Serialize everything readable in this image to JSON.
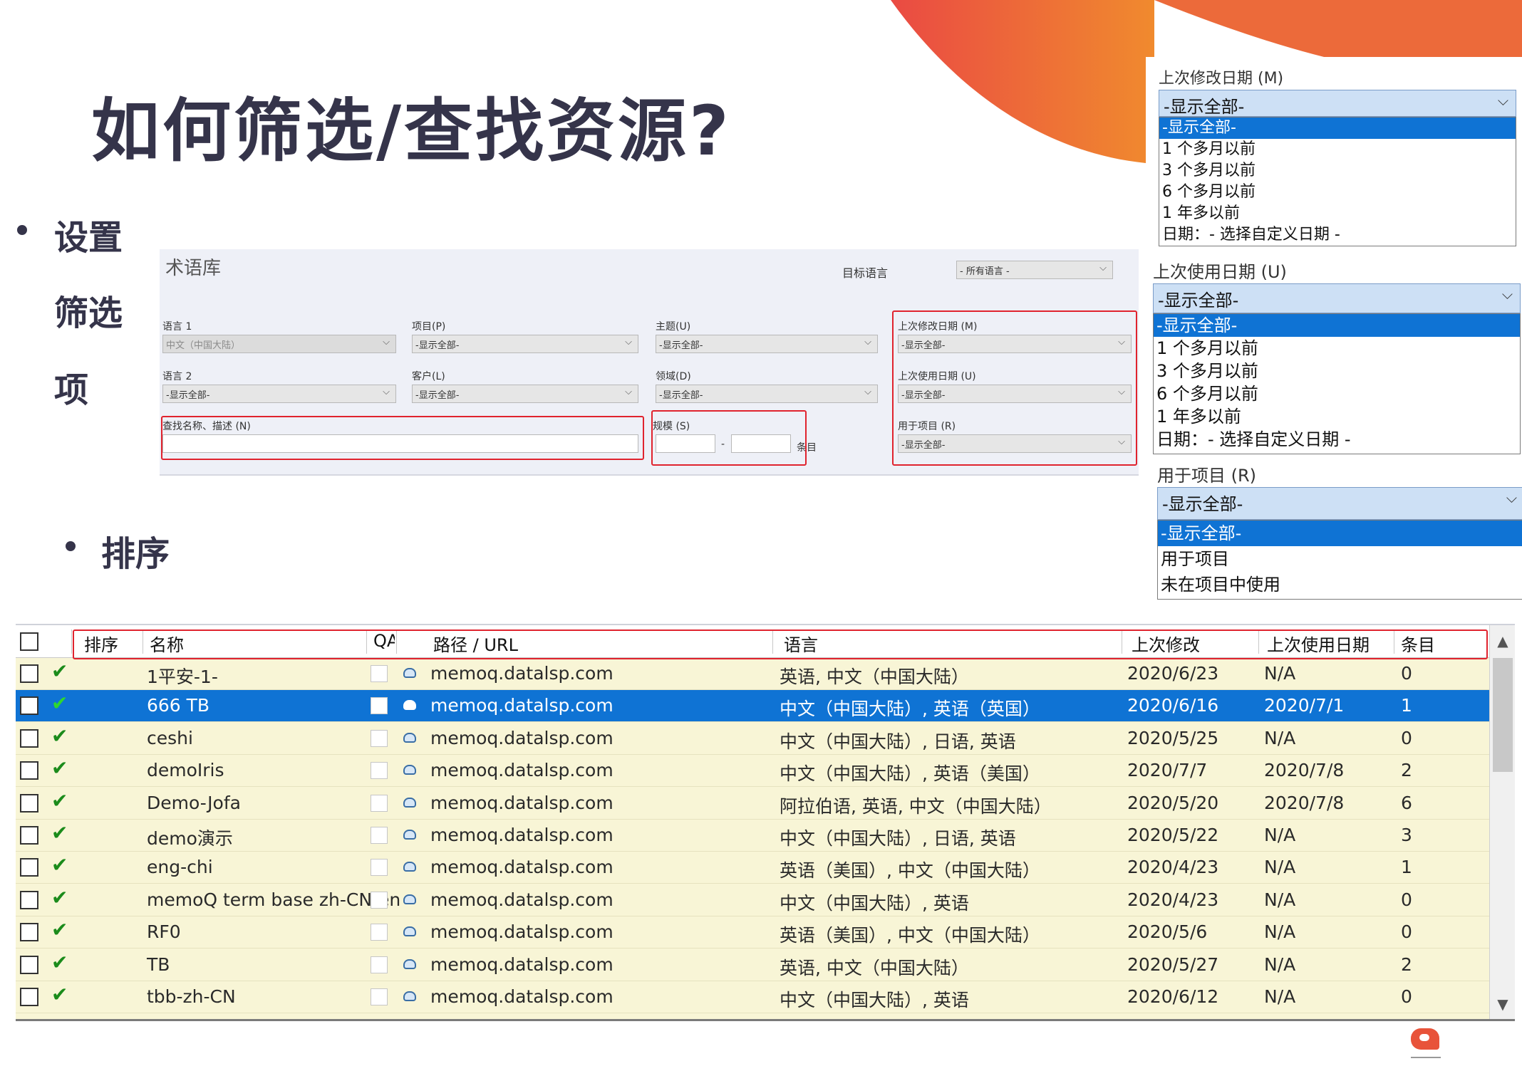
{
  "slide": {
    "title": "如何筛选/查找资源?",
    "bullet_filter_lines": [
      "设置",
      "筛选",
      "项"
    ],
    "bullet_sort": "排序"
  },
  "filter_panel": {
    "title": "术语库",
    "target_language_label": "目标语言",
    "target_language_value": "- 所有语言 -",
    "fields": {
      "lang1": {
        "label": "语言 1",
        "value": "中文（中国大陆）"
      },
      "project": {
        "label": "项目(P)",
        "value": "-显示全部-"
      },
      "subject": {
        "label": "主题(U)",
        "value": "-显示全部-"
      },
      "last_modified": {
        "label": "上次修改日期 (M)",
        "value": "-显示全部-"
      },
      "lang2": {
        "label": "语言 2",
        "value": "-显示全部-"
      },
      "client": {
        "label": "客户(L)",
        "value": "-显示全部-"
      },
      "domain": {
        "label": "领域(D)",
        "value": "-显示全部-"
      },
      "last_used": {
        "label": "上次使用日期 (U)",
        "value": "-显示全部-"
      },
      "search": {
        "label": "查找名称、描述 (N)"
      },
      "size": {
        "label": "规模 (S)",
        "dash": "-",
        "unit": "条目"
      },
      "used_in_project": {
        "label": "用于项目 (R)",
        "value": "-显示全部-"
      }
    }
  },
  "dropdowns": {
    "last_modified": {
      "label": "上次修改日期 (M)",
      "value": "-显示全部-",
      "options": [
        "-显示全部-",
        "1 个多月以前",
        "3 个多月以前",
        "6 个多月以前",
        "1 年多以前",
        "日期：- 选择自定义日期 -"
      ]
    },
    "last_used": {
      "label": "上次使用日期 (U)",
      "value": "-显示全部-",
      "options": [
        "-显示全部-",
        "1 个多月以前",
        "3 个多月以前",
        "6 个多月以前",
        "1 年多以前",
        "日期：- 选择自定义日期 -"
      ]
    },
    "used_in_project": {
      "label": "用于项目 (R)",
      "value": "-显示全部-",
      "options": [
        "-显示全部-",
        "用于项目",
        "未在项目中使用"
      ]
    }
  },
  "table": {
    "columns": [
      "排序",
      "名称",
      "QA",
      "路径 / URL",
      "语言",
      "上次修改",
      "上次使用日期",
      "条目"
    ],
    "rows": [
      {
        "name": "1平安-1-",
        "path": "memoq.datalsp.com",
        "lang": "英语, 中文（中国大陆）",
        "modified": "2020/6/23",
        "used": "N/A",
        "entries": "0",
        "selected": false
      },
      {
        "name": "666 TB",
        "path": "memoq.datalsp.com",
        "lang": "中文（中国大陆）, 英语（英国）",
        "modified": "2020/6/16",
        "used": "2020/7/1",
        "entries": "1",
        "selected": true
      },
      {
        "name": "ceshi",
        "path": "memoq.datalsp.com",
        "lang": "中文（中国大陆）, 日语, 英语",
        "modified": "2020/5/25",
        "used": "N/A",
        "entries": "0",
        "selected": false
      },
      {
        "name": "demoIris",
        "path": "memoq.datalsp.com",
        "lang": "中文（中国大陆）, 英语（美国）",
        "modified": "2020/7/7",
        "used": "2020/7/8",
        "entries": "2",
        "selected": false
      },
      {
        "name": "Demo-Jofa",
        "path": "memoq.datalsp.com",
        "lang": "阿拉伯语, 英语, 中文（中国大陆）",
        "modified": "2020/5/20",
        "used": "2020/7/8",
        "entries": "6",
        "selected": false
      },
      {
        "name": "demo演示",
        "path": "memoq.datalsp.com",
        "lang": "中文（中国大陆）, 日语, 英语",
        "modified": "2020/5/22",
        "used": "N/A",
        "entries": "3",
        "selected": false
      },
      {
        "name": "eng-chi",
        "path": "memoq.datalsp.com",
        "lang": "英语（美国）, 中文（中国大陆）",
        "modified": "2020/4/23",
        "used": "N/A",
        "entries": "1",
        "selected": false
      },
      {
        "name": "memoQ term base zh-CN-en",
        "path": "memoq.datalsp.com",
        "lang": "中文（中国大陆）, 英语",
        "modified": "2020/4/23",
        "used": "N/A",
        "entries": "0",
        "selected": false
      },
      {
        "name": "RF0",
        "path": "memoq.datalsp.com",
        "lang": "英语（美国）, 中文（中国大陆）",
        "modified": "2020/5/6",
        "used": "N/A",
        "entries": "0",
        "selected": false
      },
      {
        "name": "TB",
        "path": "memoq.datalsp.com",
        "lang": "英语, 中文（中国大陆）",
        "modified": "2020/5/27",
        "used": "N/A",
        "entries": "2",
        "selected": false
      },
      {
        "name": "tbb-zh-CN",
        "path": "memoq.datalsp.com",
        "lang": "中文（中国大陆）, 英语",
        "modified": "2020/6/12",
        "used": "N/A",
        "entries": "0",
        "selected": false
      }
    ]
  },
  "icons": {
    "check": "✔",
    "chevron": "⌵",
    "scroll_up": "▲",
    "scroll_down": "▼"
  },
  "colors": {
    "accent_red": "#e0232e",
    "selection_blue": "#0f73d4",
    "row_yellow": "#f8f5d6",
    "title_dark": "#35344a"
  }
}
